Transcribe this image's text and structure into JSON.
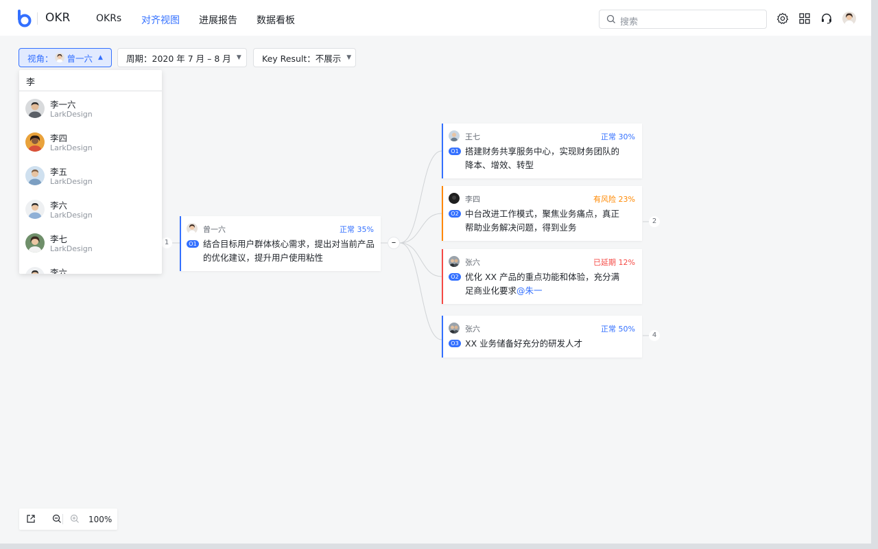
{
  "app": {
    "brand": "OKR"
  },
  "nav": [
    {
      "label": "OKRs",
      "active": false
    },
    {
      "label": "对齐视图",
      "active": true
    },
    {
      "label": "进展报告",
      "active": false
    },
    {
      "label": "数据看板",
      "active": false
    }
  ],
  "search": {
    "placeholder": "搜索"
  },
  "toolbar_icons": [
    "settings-icon",
    "apps-grid-icon",
    "headset-icon",
    "user-avatar"
  ],
  "filters": {
    "perspective": {
      "label": "视角：",
      "value": "曾一六"
    },
    "period": {
      "label": "周期：2020 年 7 月 – 8 月"
    },
    "key_result": {
      "label": "Key Result：不展示"
    }
  },
  "dropdown": {
    "query": "李",
    "items": [
      {
        "name": "李一六",
        "sub": "LarkDesign"
      },
      {
        "name": "李四",
        "sub": "LarkDesign"
      },
      {
        "name": "李五",
        "sub": "LarkDesign"
      },
      {
        "name": "李六",
        "sub": "LarkDesign"
      },
      {
        "name": "李七",
        "sub": "LarkDesign"
      },
      {
        "name": "李六",
        "sub": ""
      }
    ]
  },
  "root": {
    "owner": "曾一六",
    "status": "正常 35%",
    "tag": "O1",
    "text": "结合目标用户群体核心需求，提出对当前产品的优化建议，提升用户使用粘性",
    "left_count": "1"
  },
  "children": [
    {
      "owner": "王七",
      "status": "正常 30%",
      "tag": "O1",
      "text": "搭建财务共享服务中心，实现财务团队的降本、增效、转型",
      "mention": "",
      "count": ""
    },
    {
      "owner": "李四",
      "status": "有风险 23%",
      "tag": "O2",
      "text": "中台改进工作模式，聚焦业务痛点，真正帮助业务解决问题，得到业务",
      "mention": "",
      "count": "2"
    },
    {
      "owner": "张六",
      "status": "已延期 12%",
      "tag": "O2",
      "text": "优化 XX 产品的重点功能和体验，充分满足商业化要求",
      "mention": "@朱一",
      "count": ""
    },
    {
      "owner": "张六",
      "status": "正常 50%",
      "tag": "O3",
      "text": "XX 业务储备好充分的研发人才",
      "mention": "",
      "count": "4"
    }
  ],
  "colors": {
    "normal": "#3370ff",
    "risk": "#ff8800",
    "delayed": "#f54a45"
  },
  "zoom": {
    "value": "100%"
  }
}
